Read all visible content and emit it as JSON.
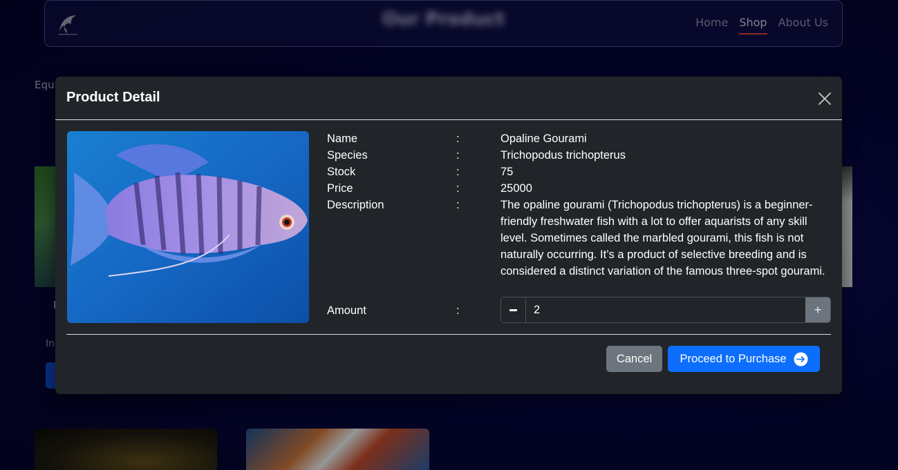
{
  "navbar": {
    "title": "Our Product",
    "links": [
      {
        "label": "Home",
        "active": false
      },
      {
        "label": "Shop",
        "active": true
      },
      {
        "label": "About Us",
        "active": false
      }
    ]
  },
  "background": {
    "category_label": "Equ",
    "card_letter": "I",
    "card_text": "In"
  },
  "modal": {
    "title": "Product Detail",
    "close_icon": "close-icon",
    "product": {
      "image_icon": "gourami-fish-image",
      "fields": [
        {
          "label": "Name",
          "separator": ":",
          "value": "Opaline Gourami"
        },
        {
          "label": "Species",
          "separator": ":",
          "value": "Trichopodus trichopterus"
        },
        {
          "label": "Stock",
          "separator": ":",
          "value": "75"
        },
        {
          "label": "Price",
          "separator": ":",
          "value": "25000"
        },
        {
          "label": "Description",
          "separator": ":",
          "value": "The opaline gourami (Trichopodus trichopterus) is a beginner-friendly freshwater fish with a lot to offer aquarists of any skill level. Sometimes called the marbled gourami, this fish is not naturally occurring. It’s a product of selective breeding and is considered a distinct variation of the famous three-spot gourami."
        }
      ],
      "amount": {
        "label": "Amount",
        "separator": ":",
        "value": "2",
        "minus_icon": "minus-icon",
        "plus_symbol": "+"
      }
    },
    "buttons": {
      "cancel_label": "Cancel",
      "proceed_label": "Proceed to Purchase",
      "proceed_icon": "arrow-right-circle-icon"
    }
  },
  "colors": {
    "modal_bg": "#212529",
    "primary": "#0d6efd",
    "secondary": "#6c757d",
    "active_underline": "#d9473a"
  }
}
